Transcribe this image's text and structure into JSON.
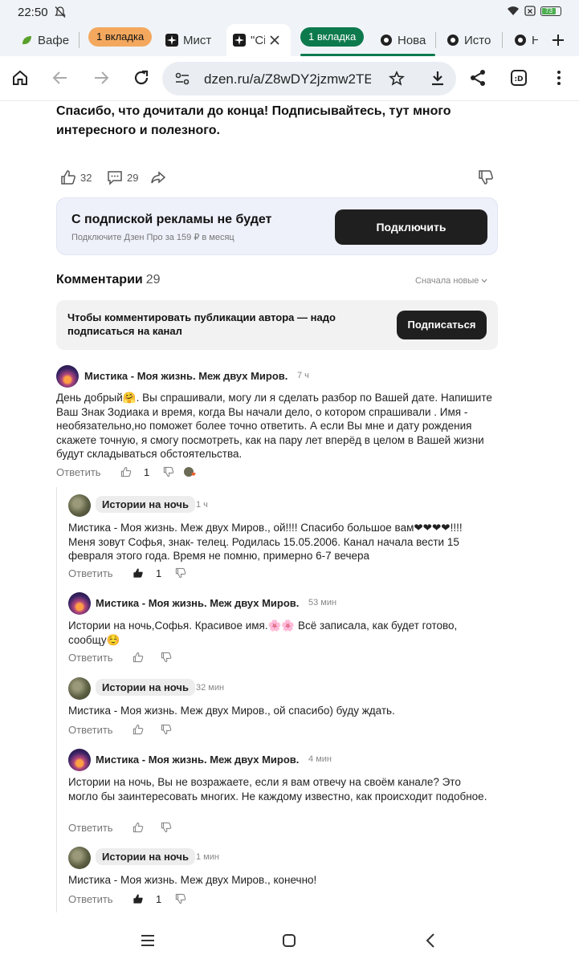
{
  "status_bar": {
    "time": "22:50",
    "battery": "73"
  },
  "tabs": [
    {
      "label": "Вафе"
    },
    {
      "label": "Мист"
    },
    {
      "label": "\"Сі"
    },
    {
      "label": "Нова"
    },
    {
      "label": "Исто"
    },
    {
      "label": "Н"
    }
  ],
  "tab_groups": [
    {
      "label": "1 вкладка",
      "color": "#f4a85e"
    },
    {
      "label": "1 вкладка",
      "color": "#0d7a4d"
    }
  ],
  "toolbar": {
    "url": "dzen.ru/a/Z8wDY2jzmw2TE"
  },
  "article": {
    "outro": "Спасибо, что дочитали до конца! Подписывайтесь, тут много интересного и полезного.",
    "likes": "32",
    "comments": "29"
  },
  "promo": {
    "title": "С подпиской рекламы не будет",
    "subtitle": "Подключите Дзен Про за 159 ₽ в месяц",
    "button": "Подключить"
  },
  "comments_section": {
    "title": "Комментарии",
    "count": "29",
    "sort": "Сначала новые",
    "subscribe_notice": "Чтобы комментировать публикации автора — надо подписаться на канал",
    "subscribe_button": "Подписаться",
    "reply_label": "Ответить",
    "items": [
      {
        "author": "Мистика - Моя жизнь. Меж двух Миров.",
        "time": "7 ч",
        "text": "День добрый🤗. Вы спрашивали, могу ли я сделать разбор по Вашей дате. Напишите Ваш Знак Зодиака и время, когда Вы начали дело, о котором спрашивали . Имя - необязательно,но поможет более точно ответить. А если Вы мне и дату рождения скажете точную, я смогу посмотреть, как на пару лет вперёд в целом в Вашей жизни будут складываться обстоятельства.",
        "likes": "1"
      },
      {
        "author": "Истории на ночь",
        "time": "1 ч",
        "text": "Мистика - Моя жизнь. Меж двух Миров., ой!!!! Спасибо большое вам❤❤❤❤!!!! Меня зовут Софья, знак- телец. Родилась 15.05.2006. Канал начала вести 15 февраля этого года. Время не помню, примерно 6-7 вечера",
        "likes": "1"
      },
      {
        "author": "Мистика - Моя жизнь. Меж двух Миров.",
        "time": "53 мин",
        "text": "Истории на ночь,Софья. Красивое имя.🌸🌸 Всё записала, как будет готово, сообщу☺️"
      },
      {
        "author": "Истории на ночь",
        "time": "32 мин",
        "text": "Мистика - Моя жизнь. Меж двух Миров., ой спасибо) буду ждать."
      },
      {
        "author": "Мистика - Моя жизнь. Меж двух Миров.",
        "time": "4 мин",
        "text": "Истории на ночь, Вы не возражаете, если я вам отвечу на своём канале? Это могло бы заинтересовать многих. Не каждому известно, как происходит подобное."
      },
      {
        "author": "Истории на ночь",
        "time": "1 мин",
        "text": "Мистика - Моя жизнь. Меж двух Миров., конечно!",
        "likes": "1"
      }
    ]
  }
}
